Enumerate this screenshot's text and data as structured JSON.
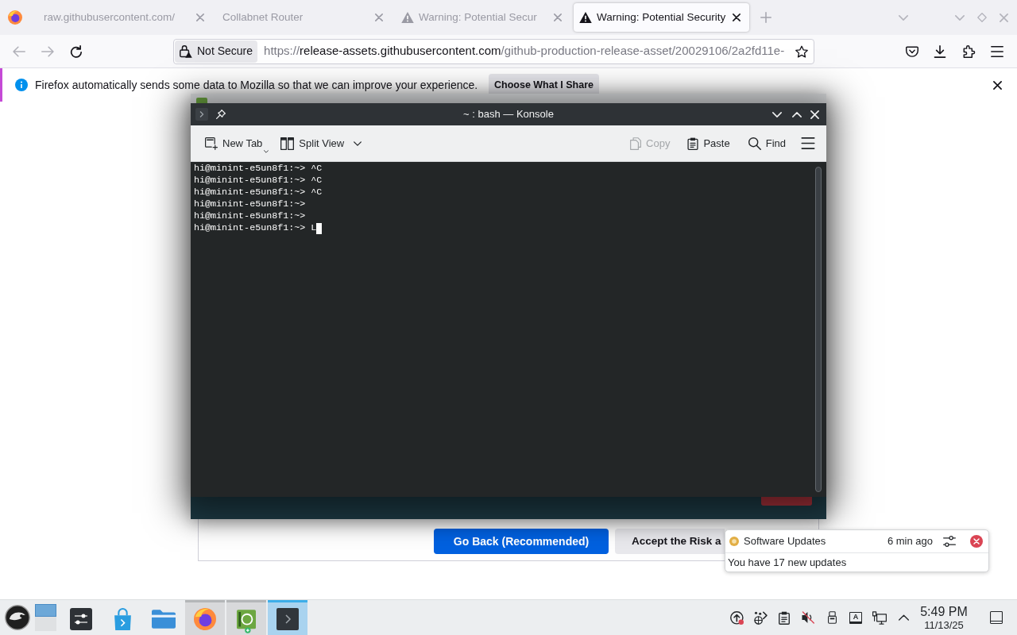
{
  "browser": {
    "tabs": [
      {
        "title": "raw.githubusercontent.com/",
        "kind": "plain",
        "selected": false
      },
      {
        "title": "Collabnet Router",
        "kind": "plain",
        "selected": false
      },
      {
        "title": "Warning: Potential Secur",
        "kind": "warning",
        "selected": false
      },
      {
        "title": "Warning: Potential Security",
        "kind": "warning",
        "selected": true
      }
    ],
    "address_bar": {
      "security_label": "Not Secure",
      "url": [
        {
          "text": "https://",
          "kind": "dim"
        },
        {
          "text": "release-assets.githubusercontent.com",
          "kind": "host"
        },
        {
          "text": "/github-production-release-asset/20029106/2a2fd11e-",
          "kind": "dim"
        }
      ]
    },
    "notification_bar": {
      "message": "Firefox automatically sends some data to Mozilla so that we can improve your experience.",
      "button": "Choose What I Share"
    },
    "page": {
      "buttons": [
        {
          "label": "Go Back (Recommended)",
          "kind": "primary"
        },
        {
          "label": "Accept the Risk a",
          "kind": "secondary"
        }
      ]
    }
  },
  "konsole": {
    "title": "~ : bash — Konsole",
    "toolbar": {
      "left": [
        {
          "label": "New Tab",
          "kind": "new-tab",
          "disabled": false
        },
        {
          "label": "Split View",
          "kind": "split-view",
          "disabled": false
        }
      ],
      "right": [
        {
          "label": "Copy",
          "kind": "copy",
          "disabled": true
        },
        {
          "label": "Paste",
          "kind": "paste",
          "disabled": false
        },
        {
          "label": "Find",
          "kind": "find",
          "disabled": false
        }
      ]
    },
    "lines": [
      {
        "text": "hi@minint-e5un8f1:~> ^C",
        "cursor": false
      },
      {
        "text": "hi@minint-e5un8f1:~> ^C",
        "cursor": false
      },
      {
        "text": "hi@minint-e5un8f1:~> ^C",
        "cursor": false
      },
      {
        "text": "hi@minint-e5un8f1:~>",
        "cursor": false
      },
      {
        "text": "hi@minint-e5un8f1:~>",
        "cursor": false
      },
      {
        "text": "hi@minint-e5un8f1:~> L",
        "cursor": true
      }
    ]
  },
  "notification": {
    "app": "Software Updates",
    "time": "6 min ago",
    "body": "You have 17 new updates"
  },
  "taskbar": {
    "tasks": [
      {
        "kind": "settings",
        "running": false,
        "selected": false
      },
      {
        "kind": "store",
        "running": false,
        "selected": false
      },
      {
        "kind": "files",
        "running": false,
        "selected": false
      },
      {
        "kind": "browser",
        "running": true,
        "selected": false
      },
      {
        "kind": "welcome",
        "running": true,
        "selected": false
      },
      {
        "kind": "terminal",
        "running": true,
        "selected": true
      }
    ],
    "tray": [
      {
        "kind": "updates"
      },
      {
        "kind": "network"
      },
      {
        "kind": "clipboard"
      },
      {
        "kind": "volume",
        "muted": true
      },
      {
        "kind": "device"
      },
      {
        "kind": "input",
        "label": "A"
      },
      {
        "kind": "display"
      },
      {
        "kind": "expand"
      }
    ],
    "clock": {
      "time": "5:49 PM",
      "date": "11/13/25"
    }
  }
}
